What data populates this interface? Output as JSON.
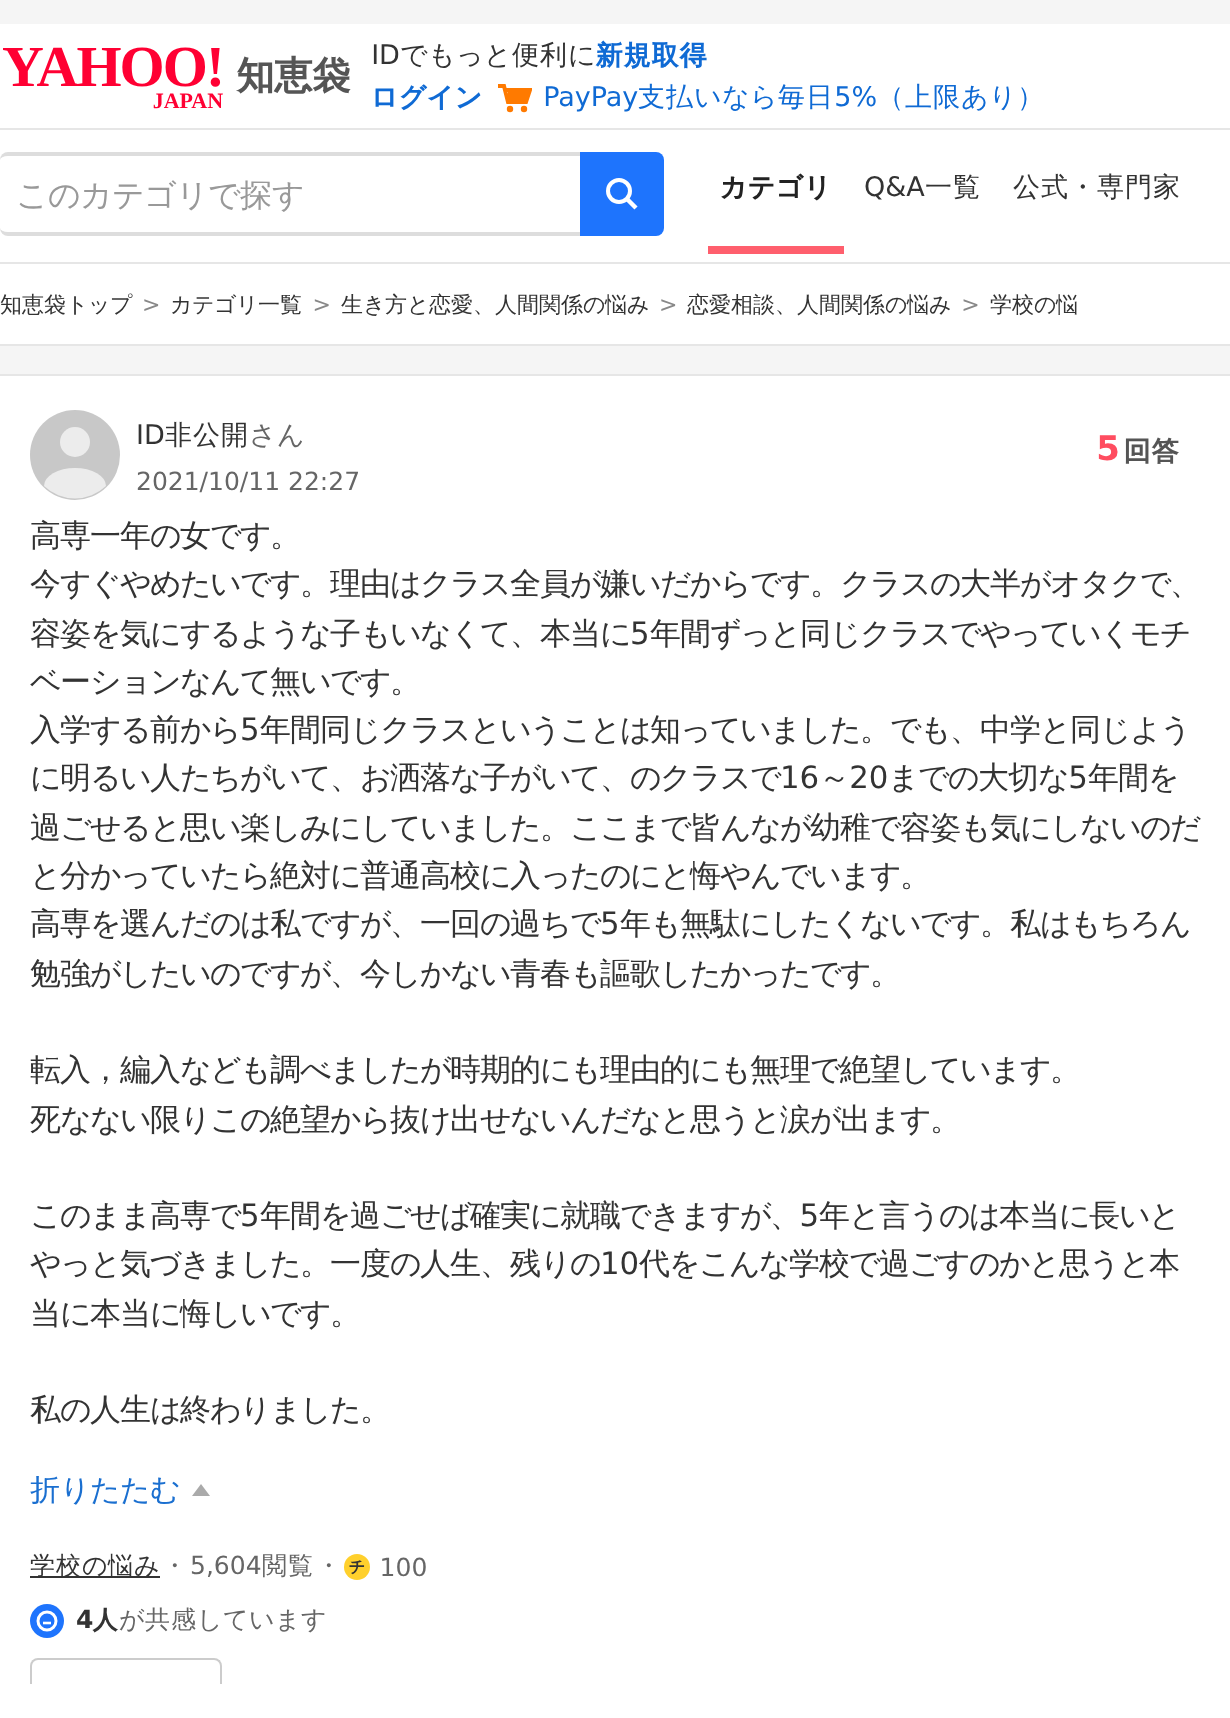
{
  "header": {
    "logo": {
      "wordmark": "YAHOO!",
      "sub": "JAPAN",
      "service": "知恵袋"
    },
    "promo": "IDでもっと便利に",
    "signup_link": "新規取得",
    "login_link": "ログイン",
    "paypay_link": "PayPay支払いなら毎日5%（上限あり）"
  },
  "search": {
    "placeholder": "このカテゴリで探す"
  },
  "tabs": [
    {
      "label": "カテゴリ",
      "selected": true
    },
    {
      "label": "Q&A一覧",
      "selected": false
    },
    {
      "label": "公式・専門家",
      "selected": false
    }
  ],
  "breadcrumb_separator": ">",
  "breadcrumb": [
    "知恵袋トップ",
    "カテゴリ一覧",
    "生き方と恋愛、人間関係の悩み",
    "恋愛相談、人間関係の悩み",
    "学校の悩"
  ],
  "question": {
    "author": "ID非公開",
    "author_suffix": "さん",
    "date": "2021/10/11 22:27",
    "answer_count": "5",
    "answer_label": "回答",
    "body": [
      [
        "高専一年の女です。",
        "今すぐやめたいです。理由はクラス全員が嫌いだからです。クラスの大半がオタクで、容姿を気にするような子もいなくて、本当に5年間ずっと同じクラスでやっていくモチベーションなんて無いです。",
        "入学する前から5年間同じクラスということは知っていました。でも、中学と同じように明るい人たちがいて、お洒落な子がいて、のクラスで16～20までの大切な5年間を過ごせると思い楽しみにしていました。ここまで皆んなが幼稚で容姿も気にしないのだと分かっていたら絶対に普通高校に入ったのにと悔やんでいます。",
        "高専を選んだのは私ですが、一回の過ちで5年も無駄にしたくないです。私はもちろん勉強がしたいのですが、今しかない青春も謳歌したかったです。"
      ],
      [
        "転入，編入なども調べましたが時期的にも理由的にも無理で絶望しています。",
        "死なない限りこの絶望から抜け出せないんだなと思うと涙が出ます。"
      ],
      [
        "このまま高専で5年間を過ごせば確実に就職できますが、5年と言うのは本当に長いとやっと気づきました。一度の人生、残りの10代をこんな学校で過ごすのかと思うと本当に本当に悔しいです。"
      ],
      [
        "私の人生は終わりました。"
      ]
    ],
    "collapse_link": "折りたたむ",
    "category_link": "学校の悩み",
    "meta_separator": "・",
    "views": "5,604閲覧",
    "coin_label": "チ",
    "coins": "100",
    "empathy_count": "4人",
    "empathy_text": "が共感しています"
  }
}
